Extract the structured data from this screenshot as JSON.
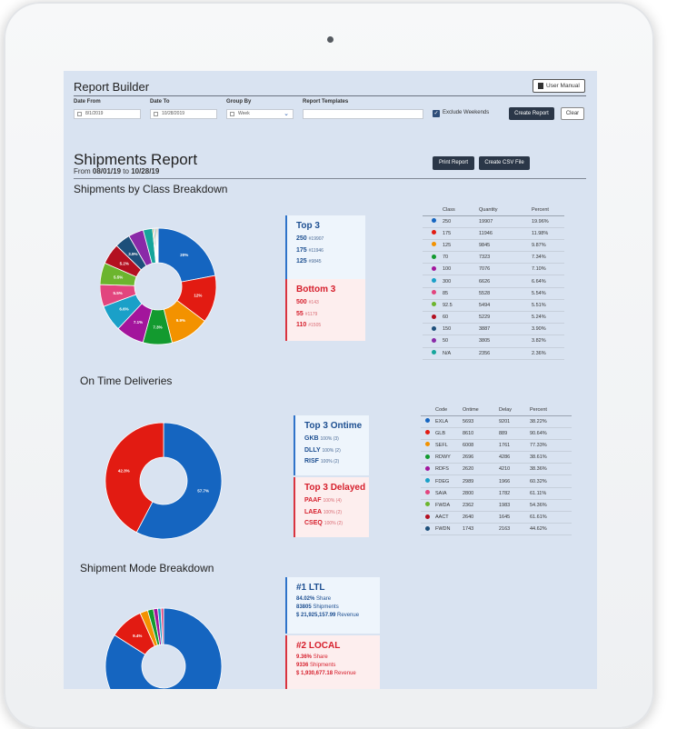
{
  "builder": {
    "title": "Report Builder",
    "user_manual": "User Manual",
    "fields": [
      {
        "label": "Date From",
        "value": "8/1/2019"
      },
      {
        "label": "Date To",
        "value": "10/28/2019"
      },
      {
        "label": "Group By",
        "value": "Week"
      },
      {
        "label": "Report Templates",
        "value": ""
      }
    ],
    "exclude_weekends": "Exclude Weekends",
    "exclude_weekends_checked": true,
    "create_report": "Create Report",
    "clear": "Clear"
  },
  "report": {
    "title": "Shipments Report",
    "range_prefix": "From",
    "from": "08/01/19",
    "range_mid": "to",
    "to": "10/28/19",
    "print": "Print Report",
    "csv": "Create CSV File"
  },
  "class_section": {
    "title": "Shipments by Class Breakdown",
    "headers": [
      "Class",
      "Quantity",
      "Percent"
    ],
    "rows": [
      {
        "color": "#1565c0",
        "cls": "250",
        "qty": "19907",
        "pct": "19.96%"
      },
      {
        "color": "#e21b12",
        "cls": "175",
        "qty": "11946",
        "pct": "11.98%"
      },
      {
        "color": "#f39200",
        "cls": "125",
        "qty": "9845",
        "pct": "9.87%"
      },
      {
        "color": "#139a2f",
        "cls": "70",
        "qty": "7323",
        "pct": "7.34%"
      },
      {
        "color": "#a3159c",
        "cls": "100",
        "qty": "7076",
        "pct": "7.10%"
      },
      {
        "color": "#1aa0c8",
        "cls": "300",
        "qty": "6626",
        "pct": "6.64%"
      },
      {
        "color": "#e2457e",
        "cls": "85",
        "qty": "5528",
        "pct": "5.54%"
      },
      {
        "color": "#6cb52e",
        "cls": "92.5",
        "qty": "5494",
        "pct": "5.51%"
      },
      {
        "color": "#b31020",
        "cls": "60",
        "qty": "5229",
        "pct": "5.24%"
      },
      {
        "color": "#1d4f7a",
        "cls": "150",
        "qty": "3887",
        "pct": "3.90%"
      },
      {
        "color": "#8a2aa8",
        "cls": "50",
        "qty": "3805",
        "pct": "3.82%"
      },
      {
        "color": "#16a59b",
        "cls": "N/A",
        "qty": "2356",
        "pct": "2.36%"
      }
    ],
    "top_title": "Top 3",
    "top": [
      {
        "code": "250",
        "sub": "#19907"
      },
      {
        "code": "175",
        "sub": "#11946"
      },
      {
        "code": "125",
        "sub": "#9845"
      }
    ],
    "bottom_title": "Bottom 3",
    "bottom": [
      {
        "code": "500",
        "sub": "#143"
      },
      {
        "code": "55",
        "sub": "#1179"
      },
      {
        "code": "110",
        "sub": "#1505"
      }
    ]
  },
  "ontime_section": {
    "title": "On Time Deliveries",
    "headers": [
      "Code",
      "Ontime",
      "Delay",
      "Percent"
    ],
    "rows": [
      {
        "color": "#1565c0",
        "code": "EXLA",
        "ontime": "5693",
        "delay": "9201",
        "pct": "38.22%"
      },
      {
        "color": "#e21b12",
        "code": "GLB",
        "ontime": "8610",
        "delay": "889",
        "pct": "90.64%"
      },
      {
        "color": "#f39200",
        "code": "SEFL",
        "ontime": "6008",
        "delay": "1761",
        "pct": "77.33%"
      },
      {
        "color": "#139a2f",
        "code": "RDWY",
        "ontime": "2696",
        "delay": "4286",
        "pct": "38.61%"
      },
      {
        "color": "#a3159c",
        "code": "RDFS",
        "ontime": "2620",
        "delay": "4210",
        "pct": "38.36%"
      },
      {
        "color": "#1aa0c8",
        "code": "FDEG",
        "ontime": "2989",
        "delay": "1966",
        "pct": "60.32%"
      },
      {
        "color": "#e2457e",
        "code": "SAIA",
        "ontime": "2800",
        "delay": "1782",
        "pct": "61.11%"
      },
      {
        "color": "#6cb52e",
        "code": "FWDA",
        "ontime": "2362",
        "delay": "1983",
        "pct": "54.36%"
      },
      {
        "color": "#b31020",
        "code": "AACT",
        "ontime": "2640",
        "delay": "1645",
        "pct": "61.61%"
      },
      {
        "color": "#1d4f7a",
        "code": "FWDN",
        "ontime": "1743",
        "delay": "2163",
        "pct": "44.62%"
      }
    ],
    "top_title": "Top 3 Ontime",
    "top": [
      {
        "code": "GKB",
        "sub": "100% (3)"
      },
      {
        "code": "DLLY",
        "sub": "100% (2)"
      },
      {
        "code": "RISF",
        "sub": "100% (2)"
      }
    ],
    "delayed_title": "Top 3 Delayed",
    "delayed": [
      {
        "code": "PAAF",
        "sub": "100% (4)"
      },
      {
        "code": "LAEA",
        "sub": "100% (2)"
      },
      {
        "code": "CSEQ",
        "sub": "100% (2)"
      }
    ]
  },
  "mode_section": {
    "title": "Shipment Mode Breakdown",
    "first_title": "#1 LTL",
    "first_lines": [
      {
        "v": "84.02%",
        "s": "Share"
      },
      {
        "v": "83805",
        "s": "Shipments"
      },
      {
        "v": "$ 21,925,157.99",
        "s": "Revenue"
      }
    ],
    "second_title": "#2 LOCAL",
    "second_lines": [
      {
        "v": "9.36%",
        "s": "Share"
      },
      {
        "v": "9336",
        "s": "Shipments"
      },
      {
        "v": "$ 1,930,677.18",
        "s": "Revenue"
      }
    ]
  },
  "chart_data": [
    {
      "type": "pie",
      "title": "Shipments by Class Breakdown",
      "categories": [
        "250",
        "175",
        "125",
        "70",
        "100",
        "300",
        "85",
        "92.5",
        "60",
        "150",
        "50",
        "N/A"
      ],
      "values": [
        19.96,
        11.98,
        9.87,
        7.34,
        7.1,
        6.64,
        5.54,
        5.51,
        5.24,
        3.9,
        3.82,
        2.36
      ],
      "labels": [
        "20%",
        "12%",
        "9.9%",
        "7.3%",
        "7.1%",
        "6.6%",
        "5.5%",
        "5.5%",
        "5.2%",
        "3.9%"
      ],
      "colors": [
        "#1565c0",
        "#e21b12",
        "#f39200",
        "#139a2f",
        "#a3159c",
        "#1aa0c8",
        "#e2457e",
        "#6cb52e",
        "#b31020",
        "#1d4f7a",
        "#8a2aa8",
        "#16a59b",
        "#c9a227",
        "#5566aa",
        "#2c9a74",
        "#e85f2a",
        "#7b7b7b"
      ],
      "extra_small_values": [
        0.3,
        0.3,
        0.3,
        0.25,
        0.25
      ]
    },
    {
      "type": "pie",
      "title": "On Time Deliveries",
      "categories": [
        "Ontime",
        "Delay"
      ],
      "values": [
        57.7,
        42.3
      ],
      "labels": [
        "57.7%",
        "42.3%"
      ],
      "colors": [
        "#1565c0",
        "#e21b12"
      ]
    },
    {
      "type": "pie",
      "title": "Shipment Mode Breakdown",
      "categories": [
        "LTL",
        "LOCAL"
      ],
      "values": [
        84.02,
        9.36,
        2.2,
        1.6,
        1.2,
        0.9,
        0.72
      ],
      "labels": [
        "",
        "9.4%"
      ],
      "colors": [
        "#1565c0",
        "#e21b12",
        "#f39200",
        "#139a2f",
        "#a3159c",
        "#1aa0c8",
        "#e2457e"
      ]
    }
  ]
}
